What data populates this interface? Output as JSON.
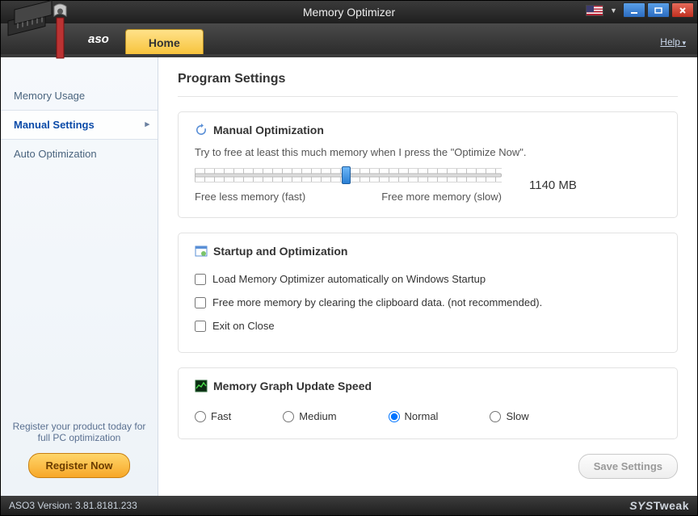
{
  "window": {
    "title": "Memory Optimizer"
  },
  "brand": "aso",
  "tabs": {
    "home": "Home"
  },
  "help": "Help",
  "sidebar": {
    "items": [
      {
        "label": "Memory Usage"
      },
      {
        "label": "Manual Settings"
      },
      {
        "label": "Auto Optimization"
      }
    ],
    "register_prompt": "Register your product today for full PC optimization",
    "register_btn": "Register Now"
  },
  "page": {
    "title": "Program Settings",
    "manual": {
      "title": "Manual Optimization",
      "hint": "Try to free at least this much memory when I press the \"Optimize Now\".",
      "less": "Free less memory (fast)",
      "more": "Free more memory (slow)",
      "value": "1140 MB"
    },
    "startup": {
      "title": "Startup and Optimization",
      "opt1": "Load Memory Optimizer automatically on Windows Startup",
      "opt2": "Free more memory by clearing the clipboard data. (not recommended).",
      "opt3": "Exit on Close"
    },
    "graph": {
      "title": "Memory Graph Update Speed",
      "opts": [
        "Fast",
        "Medium",
        "Normal",
        "Slow"
      ],
      "selected": "Normal"
    },
    "save": "Save Settings"
  },
  "status": {
    "version": "ASO3 Version: 3.81.8181.233",
    "brand": "SYSTweak"
  }
}
